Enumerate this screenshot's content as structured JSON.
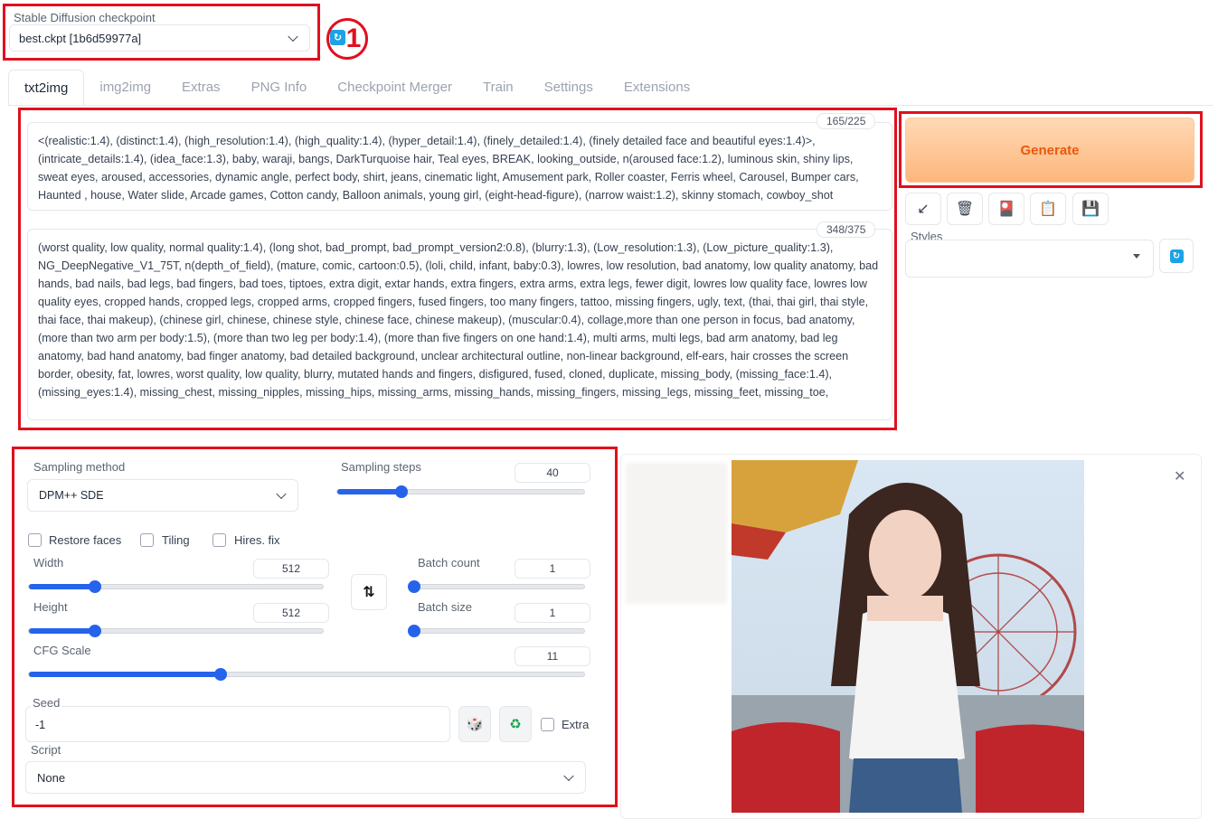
{
  "checkpoint": {
    "label": "Stable Diffusion checkpoint",
    "value": "best.ckpt [1b6d59977a]",
    "refresh_icon": "refresh-icon",
    "annotation_number": "1"
  },
  "tabs": [
    {
      "label": "txt2img",
      "active": true
    },
    {
      "label": "img2img"
    },
    {
      "label": "Extras"
    },
    {
      "label": "PNG Info"
    },
    {
      "label": "Checkpoint Merger"
    },
    {
      "label": "Train"
    },
    {
      "label": "Settings"
    },
    {
      "label": "Extensions"
    }
  ],
  "prompt": {
    "counter": "165/225",
    "text": "<(realistic:1.4), (distinct:1.4), (high_resolution:1.4), (high_quality:1.4), (hyper_detail:1.4), (finely_detailed:1.4), (finely detailed face and beautiful eyes:1.4)>, (intricate_details:1.4), (idea_face:1.3), baby, waraji, bangs, DarkTurquoise hair, Teal eyes, BREAK, looking_outside, n(aroused face:1.2), luminous skin, shiny lips, sweat eyes, aroused, accessories, dynamic angle, perfect body, shirt, jeans, cinematic light, Amusement park, Roller coaster, Ferris wheel, Carousel, Bumper cars, Haunted , house, Water slide, Arcade games, Cotton candy, Balloon animals, young girl, (eight-head-figure), (narrow waist:1.2), skinny stomach, cowboy_shot"
  },
  "negative_prompt": {
    "counter": "348/375",
    "text": "(worst quality, low quality, normal quality:1.4), (long shot, bad_prompt, bad_prompt_version2:0.8), (blurry:1.3), (Low_resolution:1.3), (Low_picture_quality:1.3), NG_DeepNegative_V1_75T, n(depth_of_field), (mature, comic, cartoon:0.5), (loli, child, infant, baby:0.3), lowres, low resolution, bad anatomy, low quality anatomy, bad hands, bad nails, bad legs, bad fingers, bad toes, tiptoes, extra digit, extar hands, extra fingers, extra arms, extra legs, fewer digit, lowres low quality face, lowres low quality eyes, cropped hands, cropped legs, cropped arms, cropped fingers, fused fingers, too many fingers, tattoo, missing fingers, ugly, text, (thai, thai girl, thai style, thai face, thai makeup), (chinese girl, chinese, chinese style, chinese face, chinese makeup), (muscular:0.4), collage,more than one person in focus, bad anatomy, (more than two arm per body:1.5), (more than two leg per body:1.4), (more than five fingers on one hand:1.4), multi arms, multi legs, bad arm anatomy, bad leg anatomy, bad hand anatomy, bad finger anatomy, bad detailed background, unclear architectural outline, non-linear background, elf-ears, hair crosses the screen border, obesity, fat, lowres, worst quality, low quality, blurry, mutated hands and fingers, disfigured, fused, cloned, duplicate, missing_body, (missing_face:1.4), (missing_eyes:1.4), missing_chest, missing_nipples, missing_hips, missing_arms, missing_hands, missing_fingers, missing_legs, missing_feet, missing_toe,"
  },
  "generate": {
    "label": "Generate"
  },
  "tools": [
    {
      "name": "read-params-icon",
      "glyph": "↙"
    },
    {
      "name": "trash-icon",
      "glyph": "🗑"
    },
    {
      "name": "extra-networks-icon",
      "glyph": "🎴"
    },
    {
      "name": "clipboard-icon",
      "glyph": "📋"
    },
    {
      "name": "save-style-icon",
      "glyph": "💾"
    }
  ],
  "styles": {
    "label": "Styles",
    "value": ""
  },
  "sampling_method": {
    "label": "Sampling method",
    "value": "DPM++ SDE"
  },
  "sampling_steps": {
    "label": "Sampling steps",
    "value": "40",
    "min": 1,
    "max": 150,
    "current": 40
  },
  "checkboxes": {
    "restore_faces": "Restore faces",
    "tiling": "Tiling",
    "hires_fix": "Hires. fix"
  },
  "width": {
    "label": "Width",
    "value": "512",
    "min": 64,
    "max": 2048,
    "current": 512
  },
  "height": {
    "label": "Height",
    "value": "512",
    "min": 64,
    "max": 2048,
    "current": 512
  },
  "batch_count": {
    "label": "Batch count",
    "value": "1",
    "min": 1,
    "max": 100,
    "current": 1
  },
  "batch_size": {
    "label": "Batch size",
    "value": "1",
    "min": 1,
    "max": 8,
    "current": 1
  },
  "cfg_scale": {
    "label": "CFG Scale",
    "value": "11",
    "min": 1,
    "max": 30,
    "current": 11
  },
  "seed": {
    "label": "Seed",
    "value": "-1",
    "extra_label": "Extra"
  },
  "script": {
    "label": "Script",
    "value": "None"
  },
  "colors": {
    "accent_blue": "#2563eb",
    "generate_text": "#ea580c",
    "annotation_red": "#e0101e"
  }
}
